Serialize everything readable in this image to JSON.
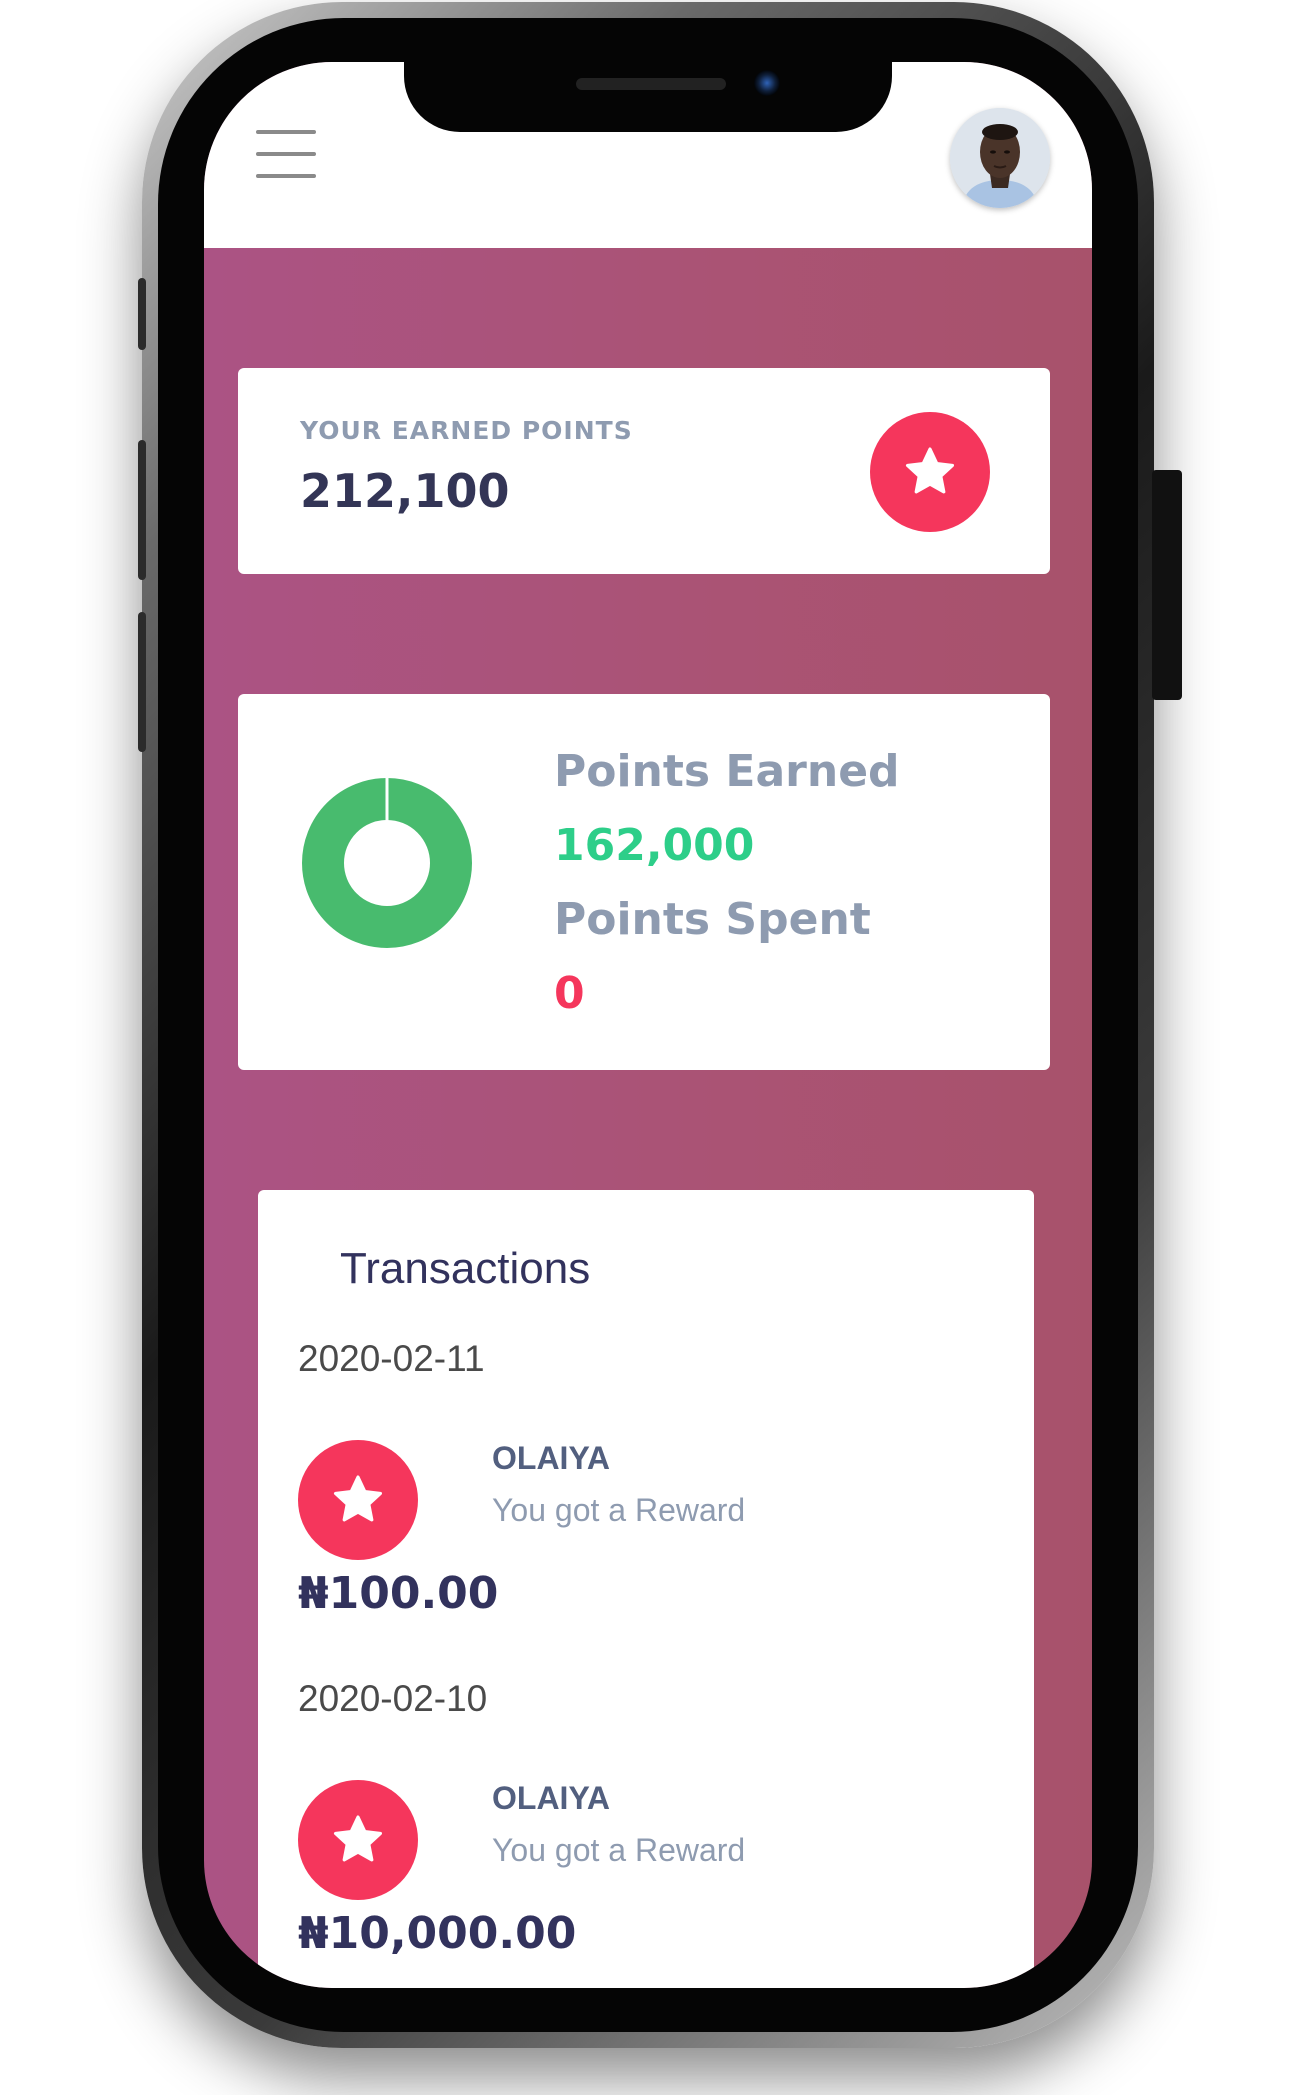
{
  "header": {
    "menu_icon": "hamburger-menu-icon",
    "avatar": "user-avatar"
  },
  "points_card": {
    "label": "YOUR EARNED POINTS",
    "value": "212,100",
    "icon": "star-icon",
    "accent_color": "#f5365c"
  },
  "stats_card": {
    "earned_label": "Points Earned",
    "earned_value": "162,000",
    "spent_label": "Points Spent",
    "spent_value": "0",
    "earned_color": "#2dce89",
    "spent_color": "#f5365c",
    "donut": {
      "earned_fraction": 1.0,
      "color": "#48bb6e"
    }
  },
  "transactions": {
    "title": "Transactions",
    "items": [
      {
        "date": "2020-02-11",
        "name": "OLAIYA",
        "description": "You got a Reward",
        "amount": "₦100.00",
        "icon": "star-icon"
      },
      {
        "date": "2020-02-10",
        "name": "OLAIYA",
        "description": "You got a Reward",
        "amount": "₦10,000.00",
        "icon": "star-icon"
      }
    ]
  },
  "theme": {
    "background_gradient": [
      "#ab5384",
      "#a8526b"
    ],
    "card_background": "#ffffff"
  }
}
